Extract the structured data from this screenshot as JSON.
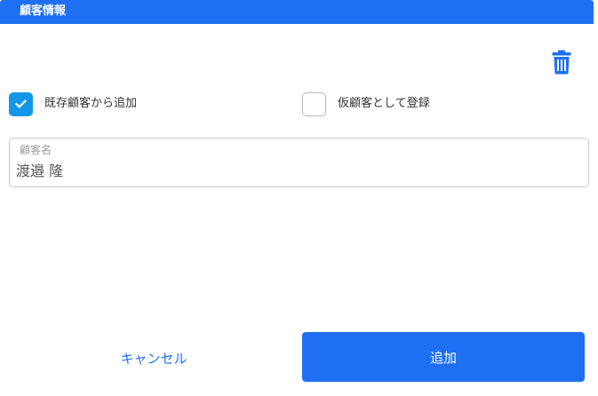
{
  "dialog": {
    "title": "顧客情報"
  },
  "toolbar": {
    "delete_icon": "trash-icon"
  },
  "options": {
    "existing_customer": {
      "label": "既存顧客から追加",
      "checked": true
    },
    "temporary_customer": {
      "label": "仮顧客として登録",
      "checked": false
    }
  },
  "customer_name": {
    "label": "顧客名",
    "value": "渡邉 隆"
  },
  "actions": {
    "cancel_label": "キャンセル",
    "add_label": "追加"
  },
  "colors": {
    "primary": "#1f6ff2",
    "checkbox_checked": "#1497e6"
  }
}
